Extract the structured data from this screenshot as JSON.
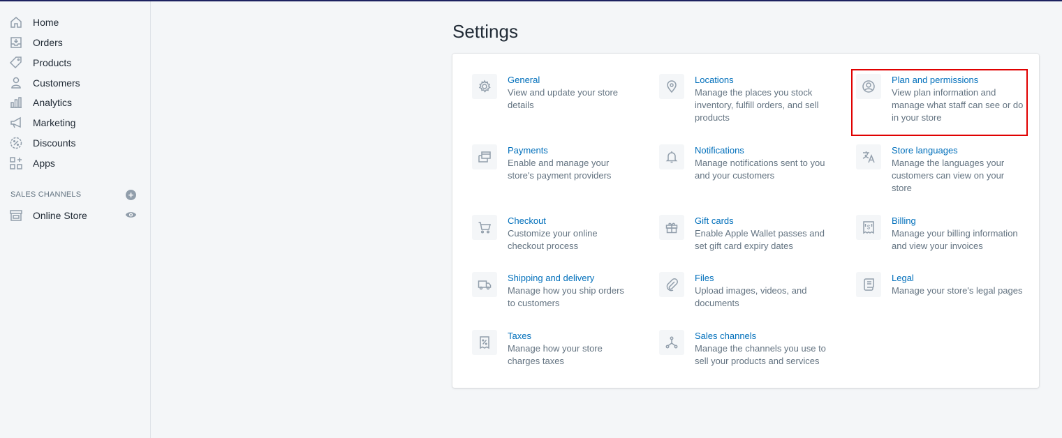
{
  "sidebar": {
    "items": [
      {
        "label": "Home",
        "icon": "home-icon"
      },
      {
        "label": "Orders",
        "icon": "orders-icon"
      },
      {
        "label": "Products",
        "icon": "tag-icon"
      },
      {
        "label": "Customers",
        "icon": "person-icon"
      },
      {
        "label": "Analytics",
        "icon": "bar-chart-icon"
      },
      {
        "label": "Marketing",
        "icon": "megaphone-icon"
      },
      {
        "label": "Discounts",
        "icon": "discount-icon"
      },
      {
        "label": "Apps",
        "icon": "apps-icon"
      }
    ],
    "sales_channels_title": "SALES CHANNELS",
    "online_store_label": "Online Store"
  },
  "page": {
    "title": "Settings"
  },
  "settings": [
    {
      "title": "General",
      "description": "View and update your store details",
      "icon": "gear-icon"
    },
    {
      "title": "Locations",
      "description": "Manage the places you stock inventory, fulfill orders, and sell products",
      "icon": "location-pin-icon"
    },
    {
      "title": "Plan and permissions",
      "description": "View plan information and manage what staff can see or do in your store",
      "icon": "user-circle-icon"
    },
    {
      "title": "Payments",
      "description": "Enable and manage your store's payment providers",
      "icon": "payments-icon"
    },
    {
      "title": "Notifications",
      "description": "Manage notifications sent to you and your customers",
      "icon": "bell-icon"
    },
    {
      "title": "Store languages",
      "description": "Manage the languages your customers can view on your store",
      "icon": "translate-icon"
    },
    {
      "title": "Checkout",
      "description": "Customize your online checkout process",
      "icon": "cart-icon"
    },
    {
      "title": "Gift cards",
      "description": "Enable Apple Wallet passes and set gift card expiry dates",
      "icon": "gift-icon"
    },
    {
      "title": "Billing",
      "description": "Manage your billing information and view your invoices",
      "icon": "billing-icon"
    },
    {
      "title": "Shipping and delivery",
      "description": "Manage how you ship orders to customers",
      "icon": "truck-icon"
    },
    {
      "title": "Files",
      "description": "Upload images, videos, and documents",
      "icon": "paperclip-icon"
    },
    {
      "title": "Legal",
      "description": "Manage your store's legal pages",
      "icon": "legal-icon"
    },
    {
      "title": "Taxes",
      "description": "Manage how your store charges taxes",
      "icon": "taxes-icon"
    },
    {
      "title": "Sales channels",
      "description": "Manage the channels you use to sell your products and services",
      "icon": "channels-icon"
    }
  ],
  "colors": {
    "link": "#006fbb",
    "highlight": "#e00000",
    "icon": "#919eab"
  }
}
